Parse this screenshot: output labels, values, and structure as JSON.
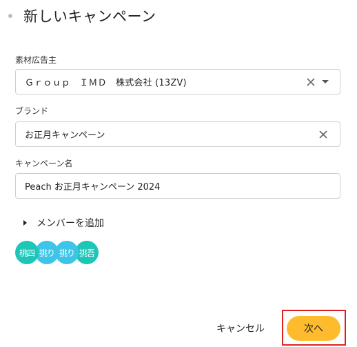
{
  "dialog": {
    "title": "新しいキャンペーン"
  },
  "advertiser": {
    "label": "素材広告主",
    "value": "Ｇｒｏｕｐ　ＩＭＤ　株式会社 (13ZV)"
  },
  "brand": {
    "label": "ブランド",
    "value": "お正月キャンペーン"
  },
  "campaign": {
    "label": "キャンペーン名",
    "value": "Peach お正月キャンペーン 2024"
  },
  "members": {
    "toggle_label": "メンバーを追加",
    "avatars": [
      {
        "text": "桃四",
        "color": "#1ec6b8"
      },
      {
        "text": "挑り",
        "color": "#3cc5e8"
      },
      {
        "text": "挑り",
        "color": "#3cc5e8"
      },
      {
        "text": "挑吾",
        "color": "#1ec6b8"
      }
    ]
  },
  "footer": {
    "cancel_label": "キャンセル",
    "next_label": "次へ"
  },
  "colors": {
    "primary_button": "#fdbb2d",
    "highlight": "#e02020"
  }
}
